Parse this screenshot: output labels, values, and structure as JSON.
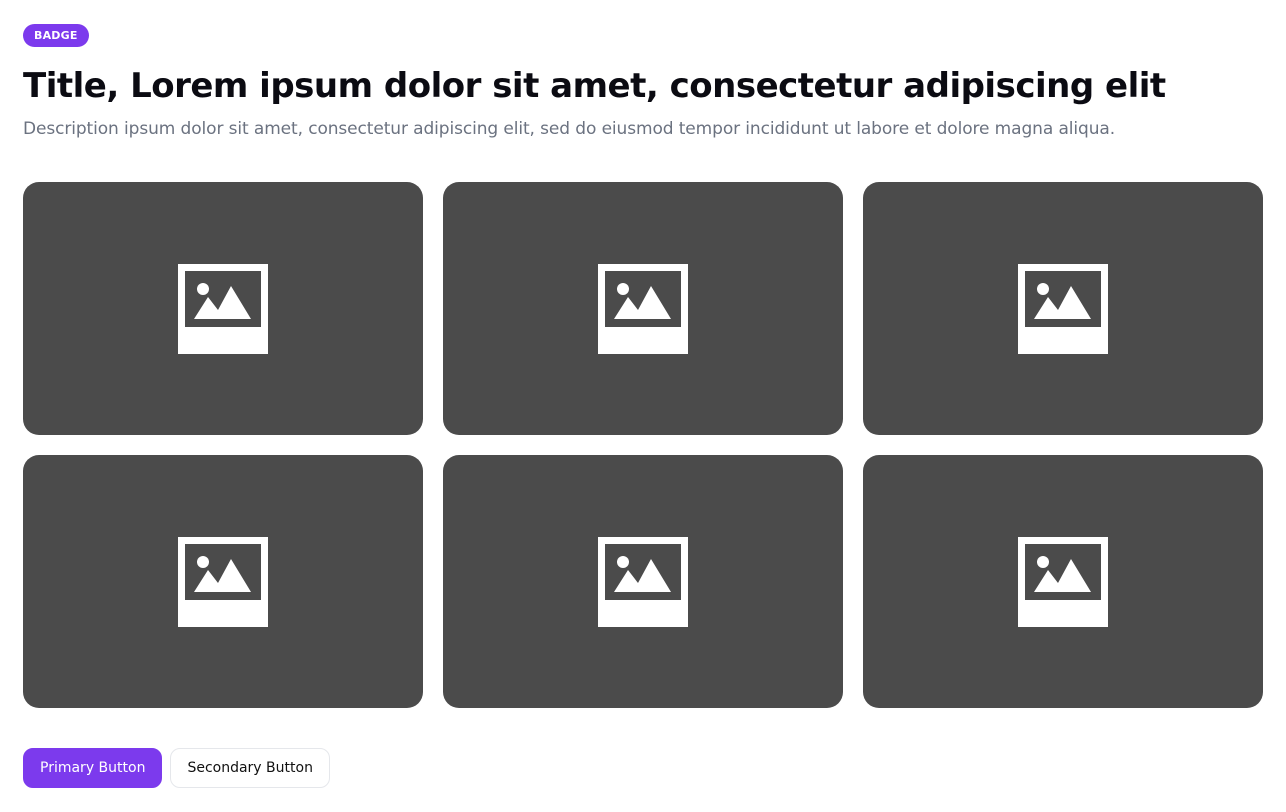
{
  "header": {
    "badge": "BADGE",
    "title": "Title, Lorem ipsum dolor sit amet, consectetur adipiscing elit",
    "description": "Description ipsum dolor sit amet, consectetur adipiscing elit, sed do eiusmod tempor incididunt ut labore et dolore magna aliqua."
  },
  "gallery": {
    "items": [
      {
        "icon": "image-placeholder-icon"
      },
      {
        "icon": "image-placeholder-icon"
      },
      {
        "icon": "image-placeholder-icon"
      },
      {
        "icon": "image-placeholder-icon"
      },
      {
        "icon": "image-placeholder-icon"
      },
      {
        "icon": "image-placeholder-icon"
      }
    ]
  },
  "actions": {
    "primary_label": "Primary Button",
    "secondary_label": "Secondary Button"
  },
  "colors": {
    "accent": "#7c3aed",
    "card_background": "#4b4b4b",
    "description_text": "#6b7280"
  }
}
